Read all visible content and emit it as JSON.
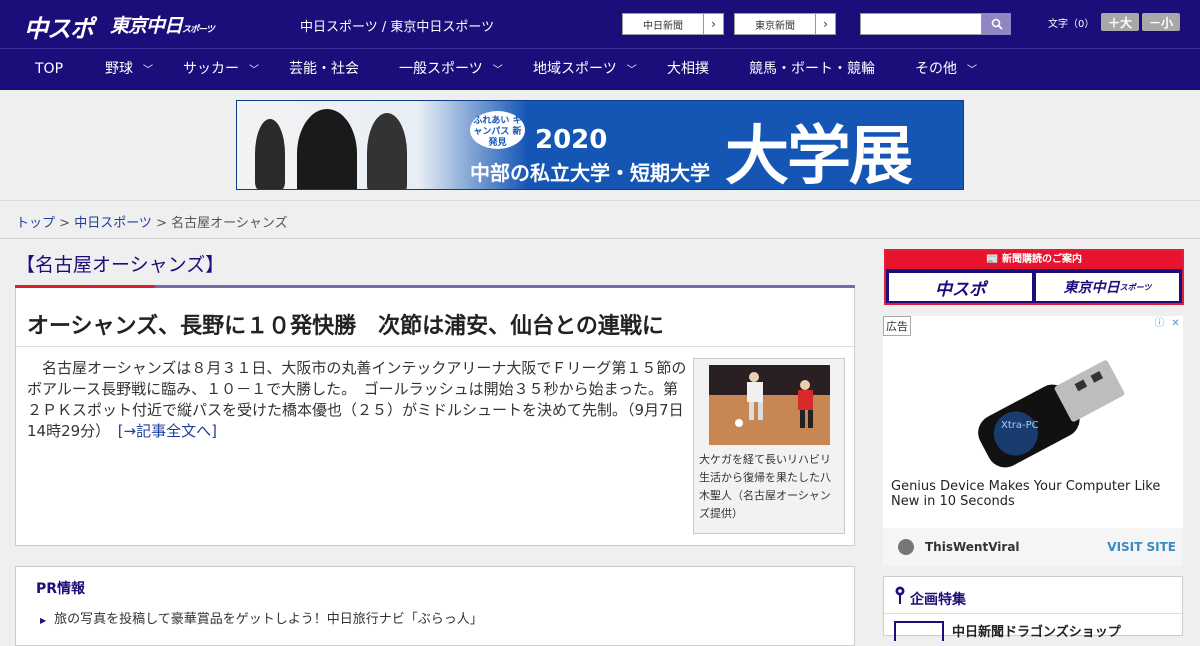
{
  "header": {
    "logo_chuspo": "中スポ",
    "logo_tokyo": "東京中日",
    "logo_tokyo_small": "スポーツ",
    "site_name": "中日スポーツ / 東京中日スポーツ",
    "paper_links": [
      "中日新聞",
      "東京新聞"
    ],
    "search_placeholder": "",
    "font_size_label": "文字（0）",
    "font_bigger": "＋大",
    "font_smaller": "－小"
  },
  "nav": [
    {
      "label": "TOP",
      "dropdown": false
    },
    {
      "label": "野球",
      "dropdown": true
    },
    {
      "label": "サッカー",
      "dropdown": true
    },
    {
      "label": "芸能・社会",
      "dropdown": false
    },
    {
      "label": "一般スポーツ",
      "dropdown": true
    },
    {
      "label": "地域スポーツ",
      "dropdown": true
    },
    {
      "label": "大相撲",
      "dropdown": false
    },
    {
      "label": "競馬・ボート・競輪",
      "dropdown": false
    },
    {
      "label": "その他",
      "dropdown": true
    }
  ],
  "banner": {
    "badge": "ふれあい キャンパス 新発見",
    "year": "2020",
    "sub": "中部の私立大学・短期大学",
    "big": "大学展"
  },
  "breadcrumb": {
    "home": "トップ",
    "sep": " > ",
    "section": "中日スポーツ",
    "current": "名古屋オーシャンズ"
  },
  "section_title": "【名古屋オーシャンズ】",
  "article": {
    "headline": "オーシャンズ、長野に１０発快勝　次節は浦安、仙台との連戦に",
    "body": "　名古屋オーシャンズは８月３１日、大阪市の丸善インテックアリーナ大阪でＦリーグ第１５節のボアルース長野戦に臨み、１０－１で大勝した。　ゴールラッシュは開始３５秒から始まった。第２ＰＫスポット付近で縦パスを受けた橋本優也（２５）がミドルシュートを決めて先制。（9月7日 14時29分）　",
    "more_link": "[→記事全文へ]",
    "photo_caption": "大ケガを経て長いリハビリ生活から復帰を果たした八木聖人（名古屋オーシャンズ提供）"
  },
  "pr": {
    "title": "PR情報",
    "items": [
      "旅の写真を投稿して豪華賞品をゲットしよう！中日旅行ナビ「ぶらっ人」"
    ]
  },
  "subscribe": {
    "header": "新聞購読のご案内",
    "chuspo": "中スポ",
    "tokyo": "東京中日",
    "tokyo_small": "スポーツ"
  },
  "ad": {
    "label": "広告",
    "headline": "Genius Device Makes Your Computer Like New in 10 Seconds",
    "source": "ThisWentViral",
    "cta": "VISIT SITE",
    "product_text": "Xtra-PC"
  },
  "kikaku": {
    "title": "企画特集",
    "item": "中日新聞ドラゴンズショップ"
  },
  "colors": {
    "brand": "#1c0e7a",
    "accent_red": "#d9212b",
    "link": "#1f3f9f"
  }
}
